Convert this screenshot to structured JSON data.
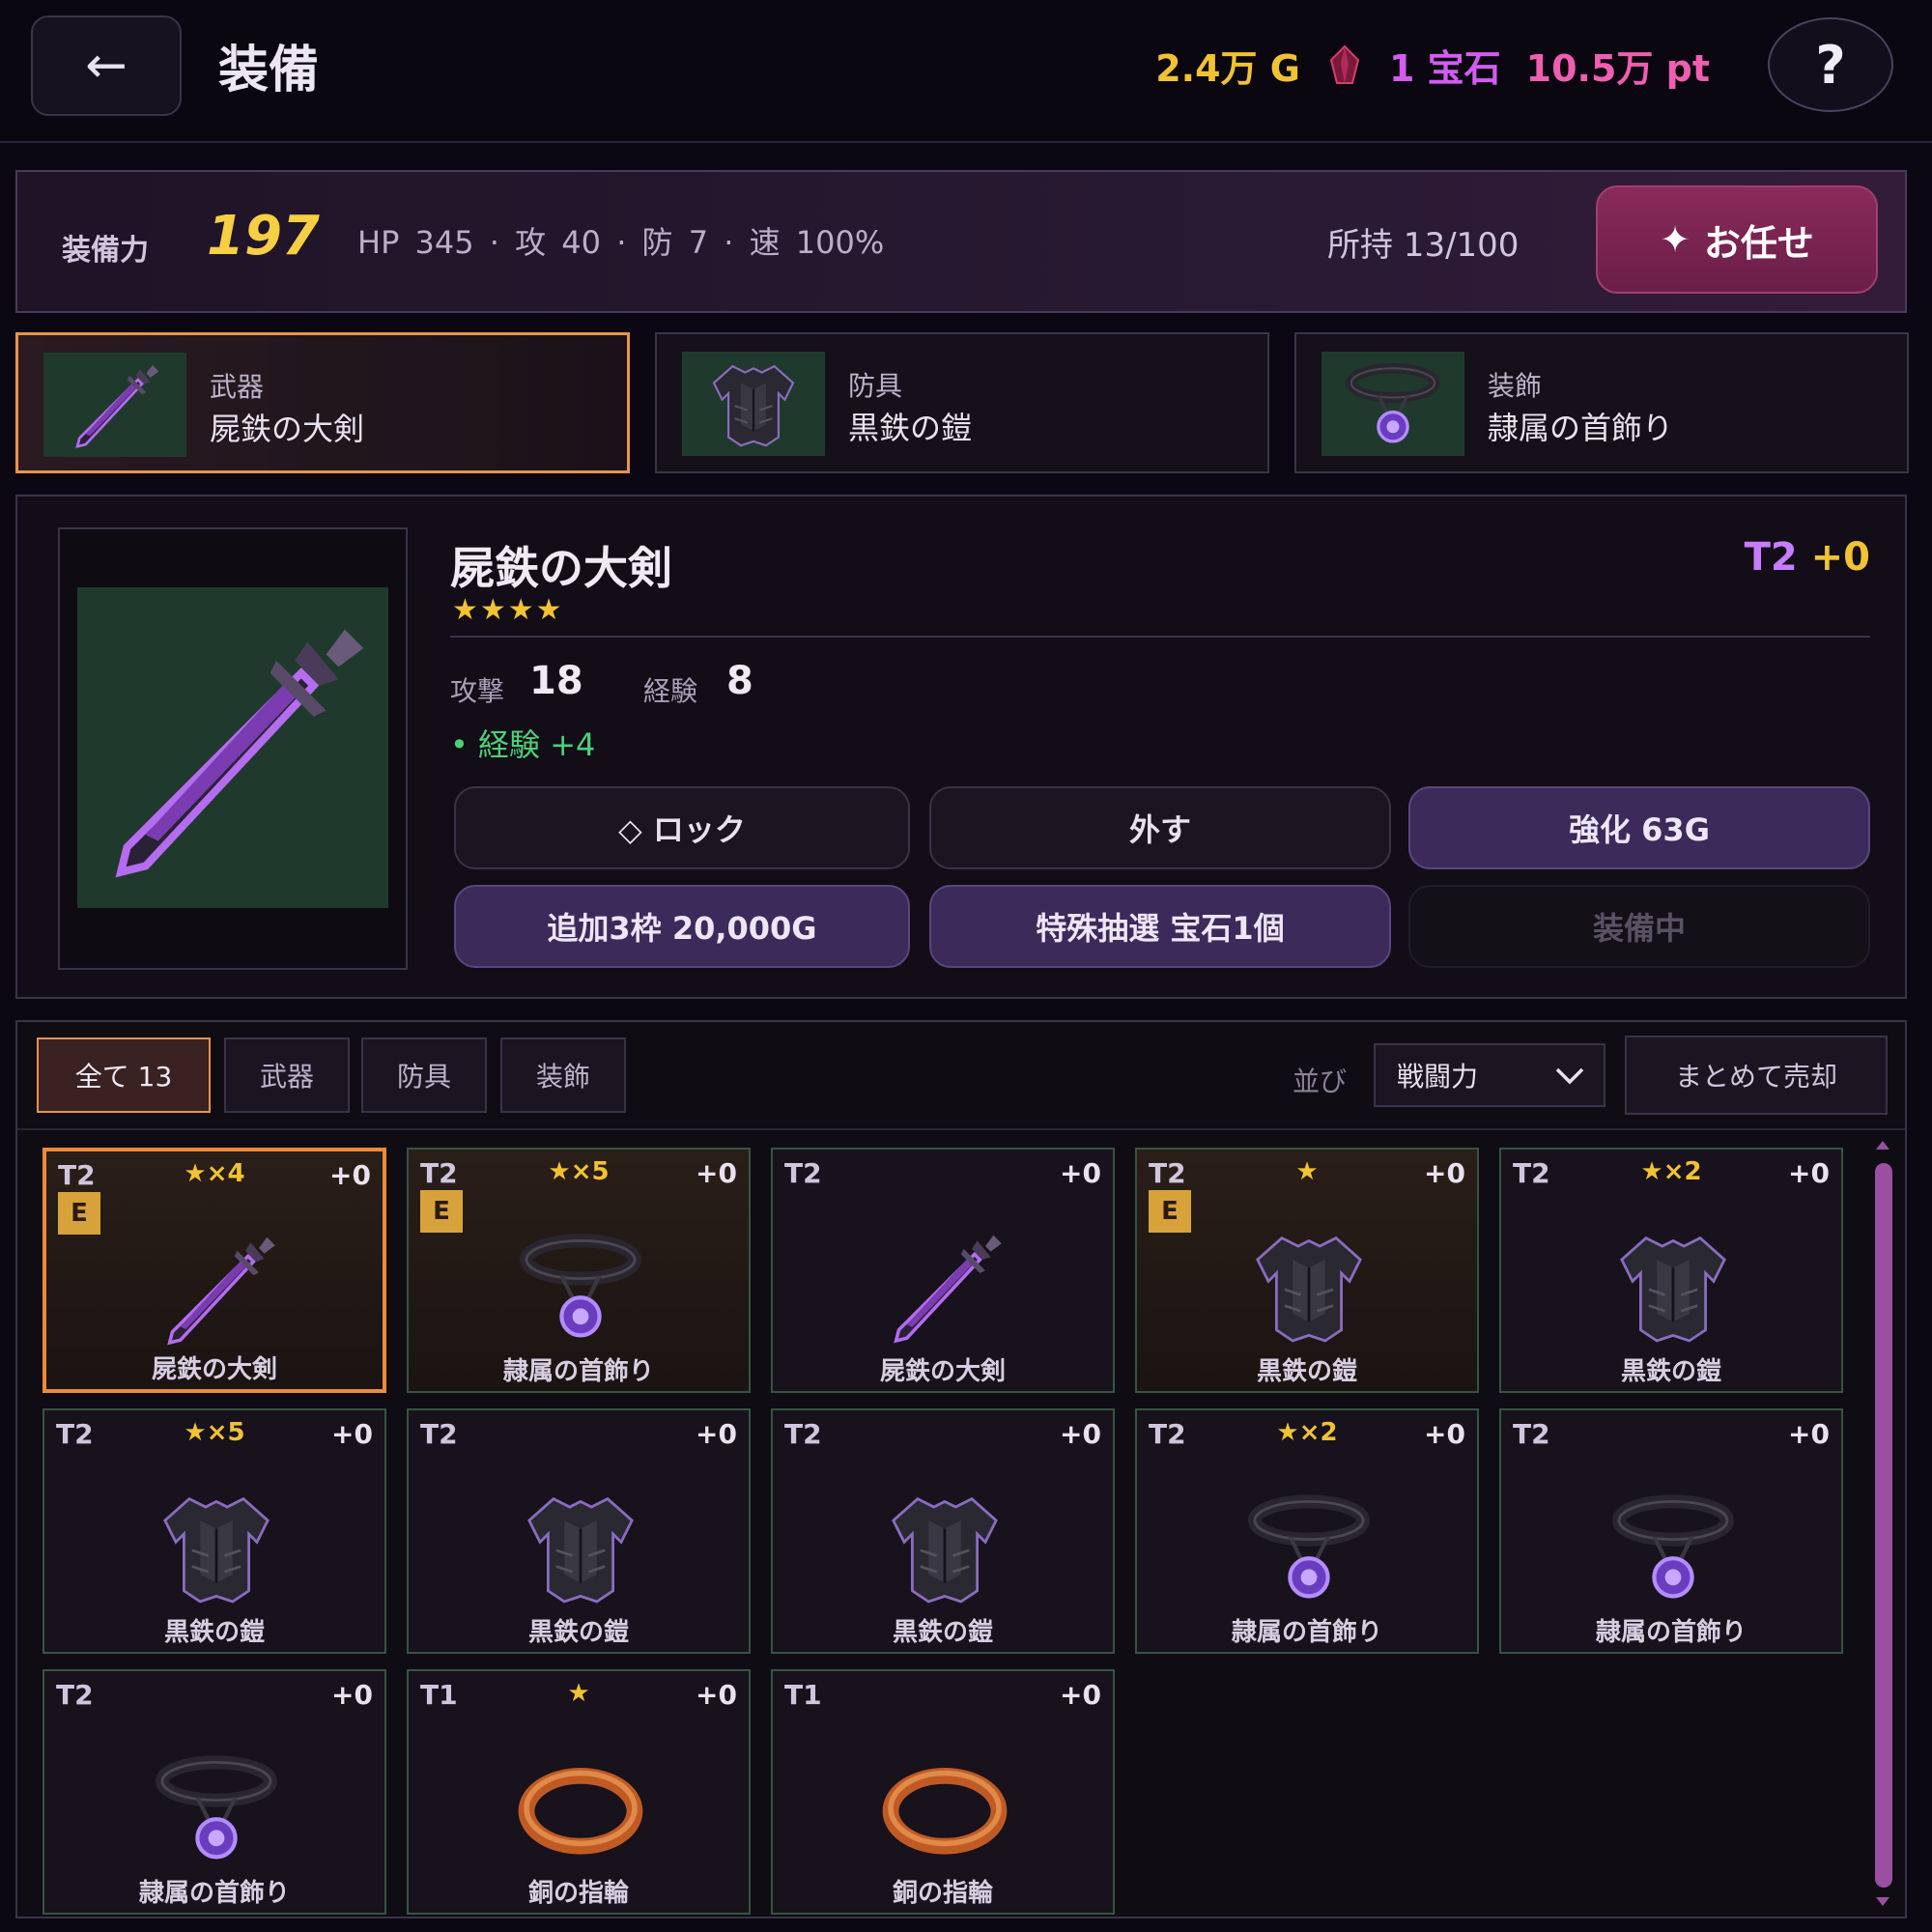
{
  "header": {
    "back_icon": "←",
    "title": "装備",
    "gold": "2.4万 G",
    "gems": "1 宝石",
    "points": "10.5万 pt",
    "help": "?"
  },
  "stats": {
    "power_label": "装備力",
    "power_value": "197",
    "line": "HP 345 · 攻 40 · 防 7 · 速 100%",
    "owned": "所持 13/100",
    "auto_label": "お任せ",
    "auto_icon": "✦"
  },
  "slots": [
    {
      "category": "武器",
      "name": "屍鉄の大剣",
      "icon": "sword-icon"
    },
    {
      "category": "防具",
      "name": "黒鉄の鎧",
      "icon": "armor-icon"
    },
    {
      "category": "装飾",
      "name": "隷属の首飾り",
      "icon": "necklace-icon"
    }
  ],
  "detail": {
    "name": "屍鉄の大剣",
    "stars": "★★★★",
    "tier": "T2",
    "plus": "+0",
    "atk_label": "攻撃",
    "atk_value": "18",
    "exp_label": "経験",
    "exp_value": "8",
    "bonus": "• 経験 +4",
    "buttons": {
      "lock": "◇ ロック",
      "unequip": "外す",
      "enhance": "強化 63G",
      "add_slots": "追加3枠 20,000G",
      "special_draw": "特殊抽選 宝石1個",
      "equipped": "装備中"
    }
  },
  "inventory": {
    "tabs": [
      "全て 13",
      "武器",
      "防具",
      "装飾"
    ],
    "sort_label": "並び",
    "sort_value": "戦闘力",
    "sell_all": "まとめて売却",
    "items": [
      {
        "tier": "T2",
        "stars": "★×4",
        "plus": "+0",
        "equipped": true,
        "name": "屍鉄の大剣",
        "icon": "sword-icon"
      },
      {
        "tier": "T2",
        "stars": "★×5",
        "plus": "+0",
        "equipped": true,
        "name": "隷属の首飾り",
        "icon": "necklace-icon"
      },
      {
        "tier": "T2",
        "stars": "",
        "plus": "+0",
        "equipped": false,
        "name": "屍鉄の大剣",
        "icon": "sword-icon"
      },
      {
        "tier": "T2",
        "stars": "★",
        "plus": "+0",
        "equipped": true,
        "name": "黒鉄の鎧",
        "icon": "armor-icon"
      },
      {
        "tier": "T2",
        "stars": "★×2",
        "plus": "+0",
        "equipped": false,
        "name": "黒鉄の鎧",
        "icon": "armor-icon"
      },
      {
        "tier": "T2",
        "stars": "★×5",
        "plus": "+0",
        "equipped": false,
        "name": "黒鉄の鎧",
        "icon": "armor-icon"
      },
      {
        "tier": "T2",
        "stars": "",
        "plus": "+0",
        "equipped": false,
        "name": "黒鉄の鎧",
        "icon": "armor-icon"
      },
      {
        "tier": "T2",
        "stars": "",
        "plus": "+0",
        "equipped": false,
        "name": "黒鉄の鎧",
        "icon": "armor-icon"
      },
      {
        "tier": "T2",
        "stars": "★×2",
        "plus": "+0",
        "equipped": false,
        "name": "隷属の首飾り",
        "icon": "necklace-icon"
      },
      {
        "tier": "T2",
        "stars": "",
        "plus": "+0",
        "equipped": false,
        "name": "隷属の首飾り",
        "icon": "necklace-icon"
      },
      {
        "tier": "T2",
        "stars": "",
        "plus": "+0",
        "equipped": false,
        "name": "隷属の首飾り",
        "icon": "necklace-icon"
      },
      {
        "tier": "T1",
        "stars": "★",
        "plus": "+0",
        "equipped": false,
        "name": "銅の指輪",
        "icon": "ring-icon"
      },
      {
        "tier": "T1",
        "stars": "",
        "plus": "+0",
        "equipped": false,
        "name": "銅の指輪",
        "icon": "ring-icon"
      }
    ],
    "equipped_badge": "E"
  },
  "colors": {
    "accent_orange": "#ef8a3a",
    "gold": "#f2c233",
    "purple": "#c77dff",
    "pink": "#f05eb0"
  }
}
